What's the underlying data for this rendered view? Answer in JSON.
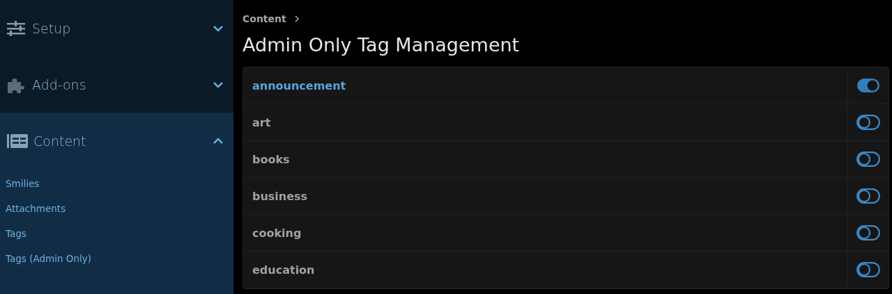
{
  "sidebar": {
    "sections": [
      {
        "label": "Setup",
        "expanded": false
      },
      {
        "label": "Add-ons",
        "expanded": false
      },
      {
        "label": "Content",
        "expanded": true,
        "children": [
          "Smilies",
          "Attachments",
          "Tags",
          "Tags (Admin Only)"
        ]
      }
    ]
  },
  "breadcrumb": [
    "Content"
  ],
  "page_title": "Admin Only Tag Management",
  "tags": [
    {
      "label": "announcement",
      "on": true
    },
    {
      "label": "art",
      "on": false
    },
    {
      "label": "books",
      "on": false
    },
    {
      "label": "business",
      "on": false
    },
    {
      "label": "cooking",
      "on": false
    },
    {
      "label": "education",
      "on": false
    }
  ]
}
